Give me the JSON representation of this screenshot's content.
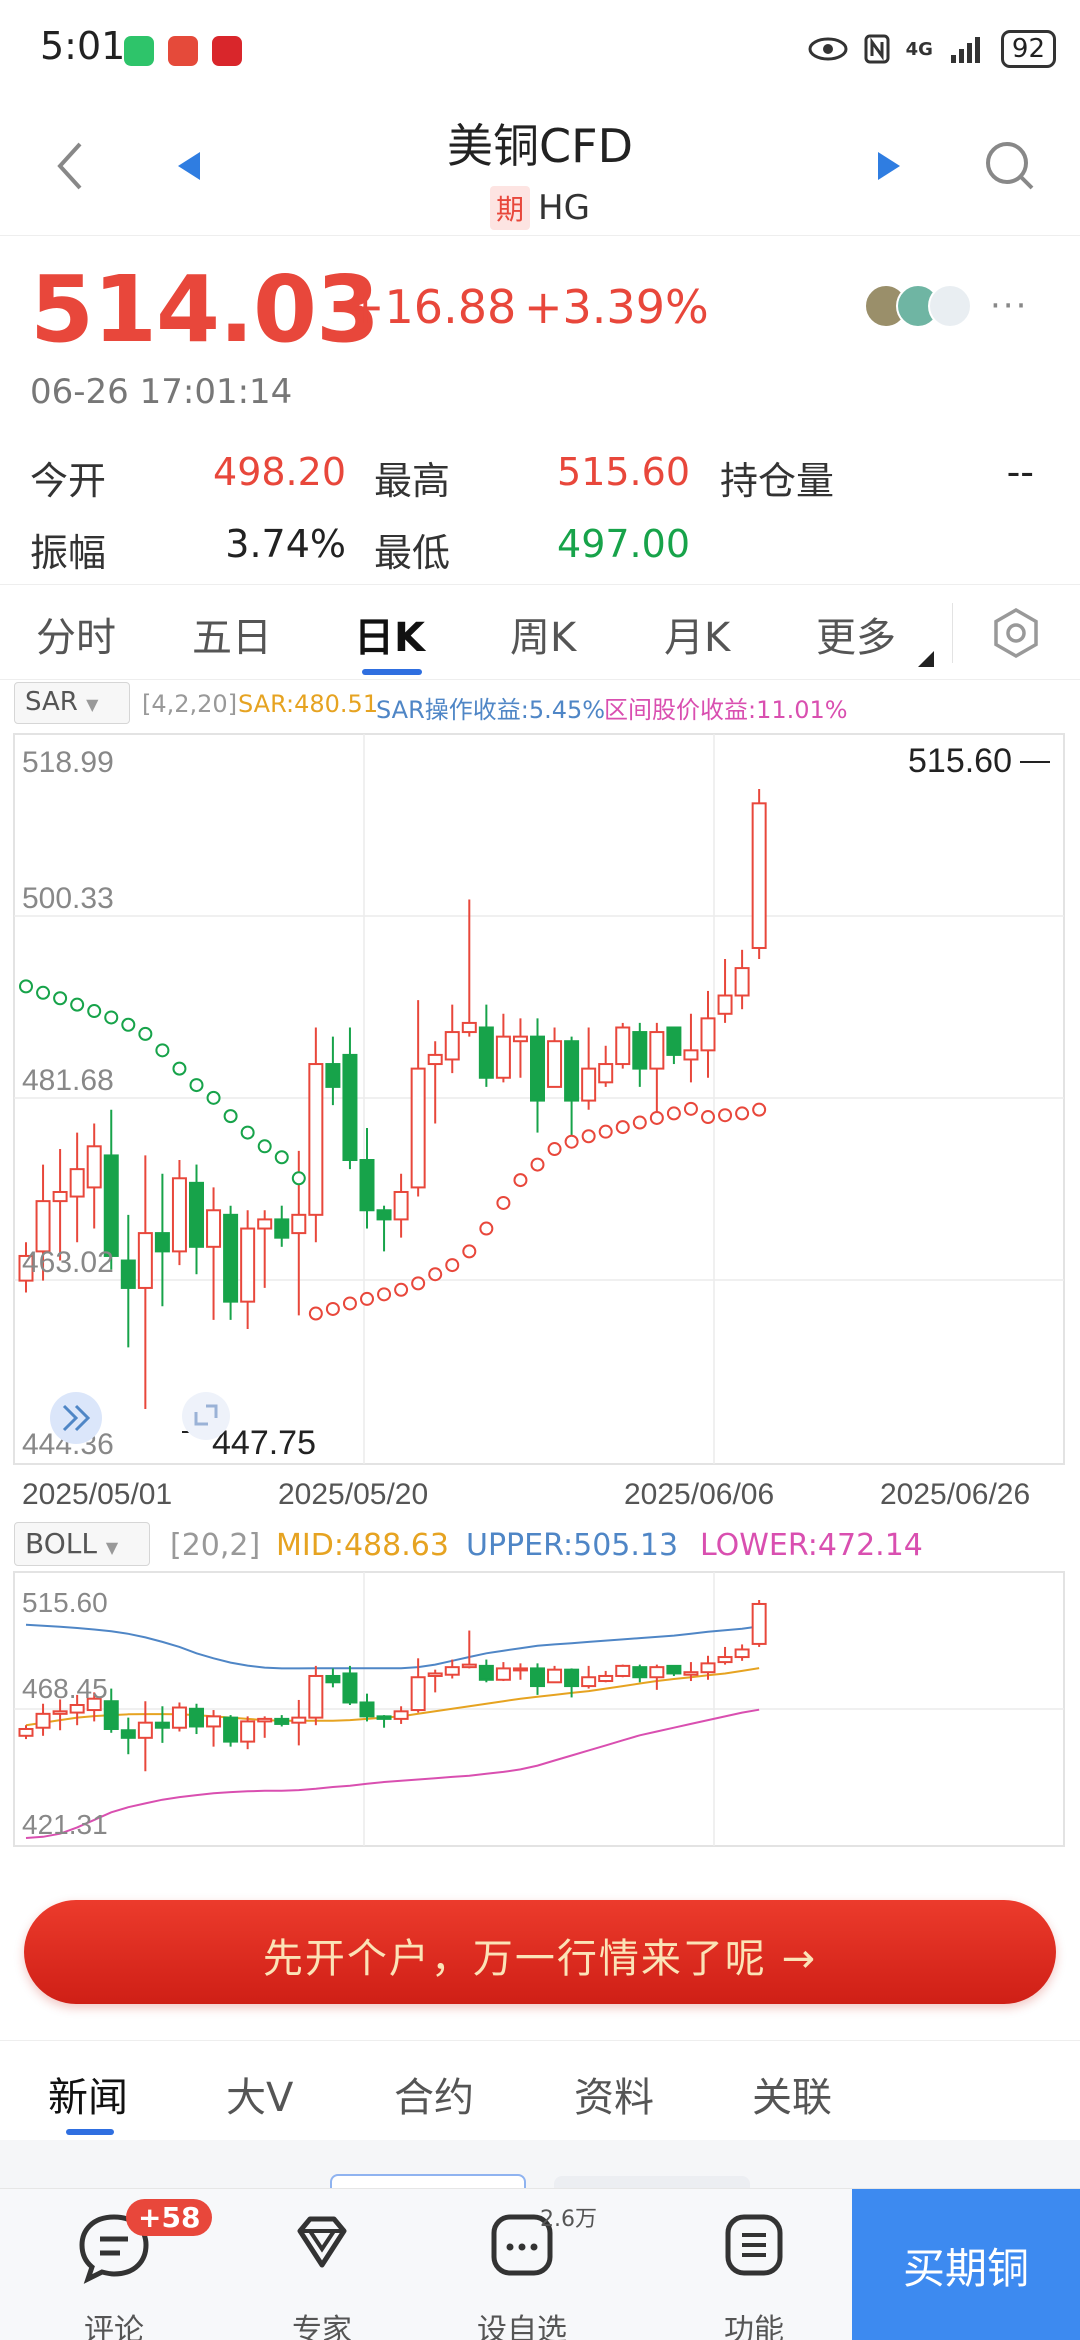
{
  "status_bar": {
    "time": "5:01",
    "network": "4G",
    "battery": "92"
  },
  "header": {
    "title": "美铜CFD",
    "badge": "期",
    "symbol": "HG"
  },
  "quote": {
    "price": "514.03",
    "change": "+16.88",
    "change_pct": "+3.39%",
    "timestamp": "06-26 17:01:14",
    "stats": [
      {
        "label": "今开",
        "value": "498.20"
      },
      {
        "label": "最高",
        "value": "515.60"
      },
      {
        "label": "持仓量",
        "value": "--"
      },
      {
        "label": "振幅",
        "value": "3.74%"
      },
      {
        "label": "最低",
        "value": "497.00"
      }
    ]
  },
  "period_tabs": [
    "分时",
    "五日",
    "日K",
    "周K",
    "月K",
    "更多"
  ],
  "main_indicator": {
    "name": "SAR",
    "params": "[4,2,20]",
    "sar": "SAR:480.51",
    "op_return": "SAR操作收益:5.45%",
    "range_return": "区间股价收益:11.01%",
    "y_labels": [
      "518.99",
      "500.33",
      "481.68",
      "463.02",
      "444.36"
    ],
    "x_labels": [
      "2025/05/01",
      "2025/05/20",
      "2025/06/06",
      "2025/06/26"
    ],
    "high_marker": "515.60",
    "low_marker": "447.75"
  },
  "sub_indicator": {
    "name": "BOLL",
    "params": "[20,2]",
    "mid": "MID:488.63",
    "upper": "UPPER:505.13",
    "lower": "LOWER:472.14",
    "y_labels": [
      "515.60",
      "468.45",
      "421.31"
    ]
  },
  "colors": {
    "up": "#e8473b",
    "down": "#17a34a",
    "mid": "#e6a321",
    "upper": "#4f86c6",
    "lower": "#d94fb0",
    "sar_up": "#e8473b",
    "sar_down": "#17a34a",
    "accent": "#2f6fe0"
  },
  "chart_data": {
    "type": "candlestick",
    "ylim_main": [
      444.36,
      518.99
    ],
    "ylim_sub": [
      421.31,
      515.6
    ],
    "candles": [
      {
        "o": 461.8,
        "c": 464.5,
        "h": 466.0,
        "l": 460.5
      },
      {
        "o": 465.0,
        "c": 470.5,
        "h": 474.5,
        "l": 461.8
      },
      {
        "o": 470.5,
        "c": 471.5,
        "h": 476.2,
        "l": 464.0
      },
      {
        "o": 471.0,
        "c": 474.0,
        "h": 478.0,
        "l": 466.0
      },
      {
        "o": 472.0,
        "c": 476.5,
        "h": 479.0,
        "l": 467.5
      },
      {
        "o": 475.5,
        "c": 464.5,
        "h": 480.5,
        "l": 463.0
      },
      {
        "o": 464.0,
        "c": 461.0,
        "h": 469.0,
        "l": 454.5
      },
      {
        "o": 461.0,
        "c": 467.0,
        "h": 475.5,
        "l": 447.75
      },
      {
        "o": 467.0,
        "c": 465.0,
        "h": 473.5,
        "l": 459.0
      },
      {
        "o": 465.0,
        "c": 473.0,
        "h": 475.0,
        "l": 463.5
      },
      {
        "o": 472.5,
        "c": 465.5,
        "h": 474.5,
        "l": 462.5
      },
      {
        "o": 465.5,
        "c": 469.5,
        "h": 472.0,
        "l": 457.5
      },
      {
        "o": 469.0,
        "c": 459.5,
        "h": 470.0,
        "l": 457.5
      },
      {
        "o": 459.5,
        "c": 467.5,
        "h": 469.5,
        "l": 456.5
      },
      {
        "o": 467.5,
        "c": 468.5,
        "h": 469.5,
        "l": 461.0
      },
      {
        "o": 468.5,
        "c": 466.5,
        "h": 470.0,
        "l": 465.5
      },
      {
        "o": 467.0,
        "c": 469.0,
        "h": 476.0,
        "l": 458.0
      },
      {
        "o": 469.0,
        "c": 485.5,
        "h": 489.5,
        "l": 466.0
      },
      {
        "o": 485.5,
        "c": 483.0,
        "h": 488.5,
        "l": 481.0
      },
      {
        "o": 486.5,
        "c": 475.0,
        "h": 489.5,
        "l": 474.0
      },
      {
        "o": 475.0,
        "c": 469.5,
        "h": 478.5,
        "l": 467.5
      },
      {
        "o": 469.5,
        "c": 468.5,
        "h": 470.0,
        "l": 465.0
      },
      {
        "o": 468.5,
        "c": 471.5,
        "h": 473.5,
        "l": 466.5
      },
      {
        "o": 472.0,
        "c": 485.0,
        "h": 492.5,
        "l": 471.0
      },
      {
        "o": 485.5,
        "c": 486.5,
        "h": 488.0,
        "l": 479.0
      },
      {
        "o": 486.0,
        "c": 489.0,
        "h": 492.0,
        "l": 484.5
      },
      {
        "o": 489.0,
        "c": 490.0,
        "h": 503.5,
        "l": 488.5
      },
      {
        "o": 489.5,
        "c": 484.0,
        "h": 492.0,
        "l": 483.0
      },
      {
        "o": 484.0,
        "c": 488.5,
        "h": 491.0,
        "l": 483.5
      },
      {
        "o": 488.0,
        "c": 488.5,
        "h": 490.5,
        "l": 484.0
      },
      {
        "o": 488.5,
        "c": 481.5,
        "h": 490.5,
        "l": 478.0
      },
      {
        "o": 483.0,
        "c": 488.0,
        "h": 489.5,
        "l": 483.0
      },
      {
        "o": 488.0,
        "c": 481.5,
        "h": 488.5,
        "l": 477.0
      },
      {
        "o": 481.5,
        "c": 485.0,
        "h": 489.5,
        "l": 480.5
      },
      {
        "o": 483.5,
        "c": 485.5,
        "h": 487.5,
        "l": 483.0
      },
      {
        "o": 485.5,
        "c": 489.5,
        "h": 490.0,
        "l": 485.0
      },
      {
        "o": 489.0,
        "c": 485.0,
        "h": 490.0,
        "l": 483.0
      },
      {
        "o": 485.0,
        "c": 489.0,
        "h": 490.0,
        "l": 480.0
      },
      {
        "o": 489.5,
        "c": 486.5,
        "h": 489.5,
        "l": 485.5
      },
      {
        "o": 486.0,
        "c": 487.0,
        "h": 491.0,
        "l": 483.5
      },
      {
        "o": 487.0,
        "c": 490.5,
        "h": 493.5,
        "l": 484.0
      },
      {
        "o": 491.0,
        "c": 493.0,
        "h": 497.0,
        "l": 490.0
      },
      {
        "o": 493.0,
        "c": 496.0,
        "h": 498.0,
        "l": 491.5
      },
      {
        "o": 498.2,
        "c": 514.03,
        "h": 515.6,
        "l": 497.0
      }
    ],
    "sar": [
      {
        "i": 0,
        "v": 494.0,
        "t": "down"
      },
      {
        "i": 1,
        "v": 493.3,
        "t": "down"
      },
      {
        "i": 2,
        "v": 492.7,
        "t": "down"
      },
      {
        "i": 3,
        "v": 492.0,
        "t": "down"
      },
      {
        "i": 4,
        "v": 491.3,
        "t": "down"
      },
      {
        "i": 5,
        "v": 490.6,
        "t": "down"
      },
      {
        "i": 6,
        "v": 489.8,
        "t": "down"
      },
      {
        "i": 7,
        "v": 488.8,
        "t": "down"
      },
      {
        "i": 8,
        "v": 487.0,
        "t": "down"
      },
      {
        "i": 9,
        "v": 485.0,
        "t": "down"
      },
      {
        "i": 10,
        "v": 483.2,
        "t": "down"
      },
      {
        "i": 11,
        "v": 481.8,
        "t": "down"
      },
      {
        "i": 12,
        "v": 479.8,
        "t": "down"
      },
      {
        "i": 13,
        "v": 478.0,
        "t": "down"
      },
      {
        "i": 14,
        "v": 476.5,
        "t": "down"
      },
      {
        "i": 15,
        "v": 475.3,
        "t": "down"
      },
      {
        "i": 16,
        "v": 473.0,
        "t": "down"
      },
      {
        "i": 17,
        "v": 458.2,
        "t": "up"
      },
      {
        "i": 18,
        "v": 458.7,
        "t": "up"
      },
      {
        "i": 19,
        "v": 459.3,
        "t": "up"
      },
      {
        "i": 20,
        "v": 459.8,
        "t": "up"
      },
      {
        "i": 21,
        "v": 460.3,
        "t": "up"
      },
      {
        "i": 22,
        "v": 460.8,
        "t": "up"
      },
      {
        "i": 23,
        "v": 461.5,
        "t": "up"
      },
      {
        "i": 24,
        "v": 462.5,
        "t": "up"
      },
      {
        "i": 25,
        "v": 463.5,
        "t": "up"
      },
      {
        "i": 26,
        "v": 465.0,
        "t": "up"
      },
      {
        "i": 27,
        "v": 467.5,
        "t": "up"
      },
      {
        "i": 28,
        "v": 470.3,
        "t": "up"
      },
      {
        "i": 29,
        "v": 472.8,
        "t": "up"
      },
      {
        "i": 30,
        "v": 474.5,
        "t": "up"
      },
      {
        "i": 31,
        "v": 476.2,
        "t": "up"
      },
      {
        "i": 32,
        "v": 477.0,
        "t": "up"
      },
      {
        "i": 33,
        "v": 477.6,
        "t": "up"
      },
      {
        "i": 34,
        "v": 478.1,
        "t": "up"
      },
      {
        "i": 35,
        "v": 478.6,
        "t": "up"
      },
      {
        "i": 36,
        "v": 479.1,
        "t": "up"
      },
      {
        "i": 37,
        "v": 479.6,
        "t": "up"
      },
      {
        "i": 38,
        "v": 480.1,
        "t": "up"
      },
      {
        "i": 39,
        "v": 480.6,
        "t": "up"
      },
      {
        "i": 40,
        "v": 479.7,
        "t": "up"
      },
      {
        "i": 41,
        "v": 479.9,
        "t": "up"
      },
      {
        "i": 42,
        "v": 480.1,
        "t": "up"
      },
      {
        "i": 43,
        "v": 480.51,
        "t": "up"
      }
    ],
    "boll_upper": [
      505.8,
      505.4,
      505.0,
      504.5,
      503.9,
      503.2,
      502.2,
      500.8,
      499.0,
      497.0,
      494.5,
      492.5,
      490.8,
      489.6,
      488.8,
      488.5,
      488.5,
      488.6,
      488.6,
      488.6,
      488.6,
      488.6,
      488.6,
      489.0,
      490.0,
      491.5,
      493.0,
      494.5,
      495.5,
      496.5,
      497.5,
      498.0,
      498.5,
      499.0,
      499.5,
      500.0,
      500.5,
      501.0,
      501.5,
      502.2,
      503.0,
      503.6,
      504.2,
      505.13
    ],
    "boll_mid": [
      466.0,
      467.0,
      468.0,
      469.0,
      469.6,
      470.0,
      470.3,
      470.4,
      470.4,
      470.3,
      470.0,
      469.5,
      469.0,
      468.5,
      468.0,
      467.8,
      467.8,
      467.8,
      467.8,
      468.0,
      468.5,
      469.0,
      469.5,
      470.5,
      471.5,
      472.5,
      473.5,
      474.5,
      475.5,
      476.5,
      477.3,
      478.0,
      478.8,
      479.5,
      480.5,
      481.5,
      482.5,
      483.5,
      484.3,
      485.0,
      485.8,
      486.5,
      487.5,
      488.63
    ],
    "boll_lower": [
      421.31,
      421.8,
      423.0,
      425.5,
      428.5,
      431.5,
      433.5,
      435.0,
      436.5,
      437.5,
      438.3,
      439.0,
      439.5,
      439.8,
      440.0,
      440.0,
      440.3,
      440.8,
      441.5,
      442.0,
      442.8,
      443.5,
      444.0,
      444.5,
      445.0,
      445.5,
      446.0,
      446.8,
      447.5,
      448.5,
      450.0,
      452.0,
      454.0,
      456.0,
      458.0,
      460.0,
      462.0,
      463.5,
      465.0,
      466.5,
      468.0,
      469.5,
      471.0,
      472.14
    ]
  },
  "cta": {
    "text": "先开个户，万一行情来了呢 →"
  },
  "news_tabs": [
    "新闻",
    "大V",
    "合约",
    "资料",
    "关联"
  ],
  "bottom_nav": {
    "comments": {
      "label": "评论",
      "badge": "+58"
    },
    "expert": {
      "label": "专家"
    },
    "watchlist": {
      "label": "设自选",
      "count": "2.6万"
    },
    "functions": {
      "label": "功能"
    },
    "buy": {
      "label": "买期铜"
    }
  }
}
